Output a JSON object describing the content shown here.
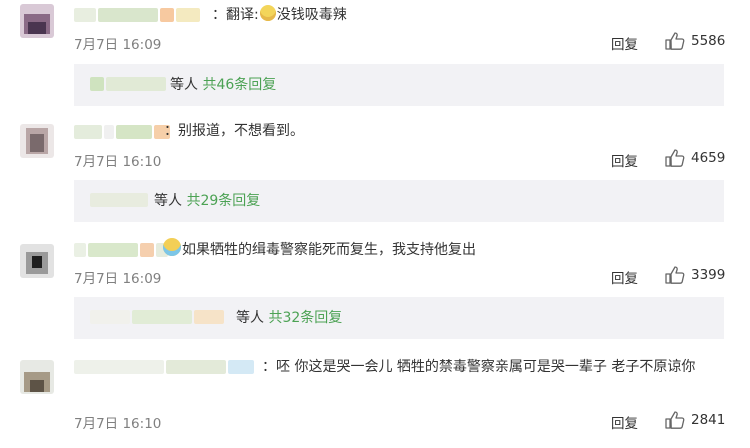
{
  "comments": [
    {
      "text_before": "：翻译:",
      "text_after": "没钱吸毒辣",
      "emoji": "cool-face-icon",
      "time": "7月7日 16:09",
      "reply_label": "回复",
      "likes": "5586",
      "replies_others": "等人",
      "replies_count": "共46条回复"
    },
    {
      "text": "：别报道，不想看到。",
      "time": "7月7日 16:10",
      "reply_label": "回复",
      "likes": "4659",
      "replies_others": "等人",
      "replies_count": "共29条回复"
    },
    {
      "emoji": "crying-face-icon",
      "text": "如果牺牲的缉毒警察能死而复生，我支持他复出",
      "time": "7月7日 16:09",
      "reply_label": "回复",
      "likes": "3399",
      "replies_others": "等人",
      "replies_count": "共32条回复"
    },
    {
      "text": "：呸  你这是哭一会儿  牺牲的禁毒警察亲属可是哭一辈子 老子不原谅你",
      "time": "7月7日 16:10",
      "reply_label": "回复",
      "likes": "2841"
    }
  ],
  "colors": {
    "link_green": "#4ca254",
    "time_gray": "#808080",
    "reply_bg": "#f2f2f5"
  }
}
